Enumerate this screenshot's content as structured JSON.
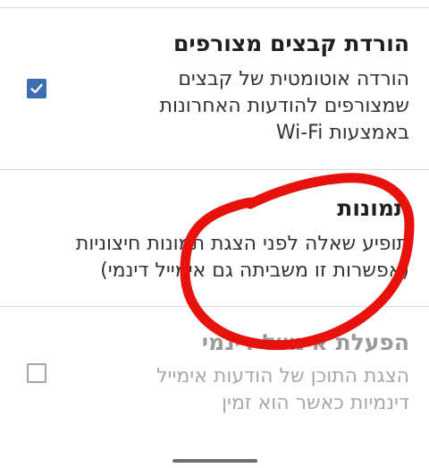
{
  "attachments": {
    "title": "הורדת קבצים מצורפים",
    "description_lines": [
      "הורדה אוטומטית של קבצים",
      "שמצורפים להודעות האחרונות",
      "באמצעות Wi-Fi"
    ],
    "checked": true
  },
  "images": {
    "title": "תמונות",
    "description_lines": [
      "תופיע שאלה לפני הצגת תמונות חיצוניות",
      "(אפשרות זו משביתה גם אימייל דינמי)"
    ]
  },
  "dynamic_email": {
    "title": "הפעלת אימייל דינמי",
    "description_lines": [
      "הצגת התוכן של הודעות אימייל",
      "דינמיות כאשר הוא זמין"
    ],
    "checked": false,
    "disabled": true
  },
  "colors": {
    "accent": "#3d6fb0",
    "annotation": "#e8120c"
  }
}
